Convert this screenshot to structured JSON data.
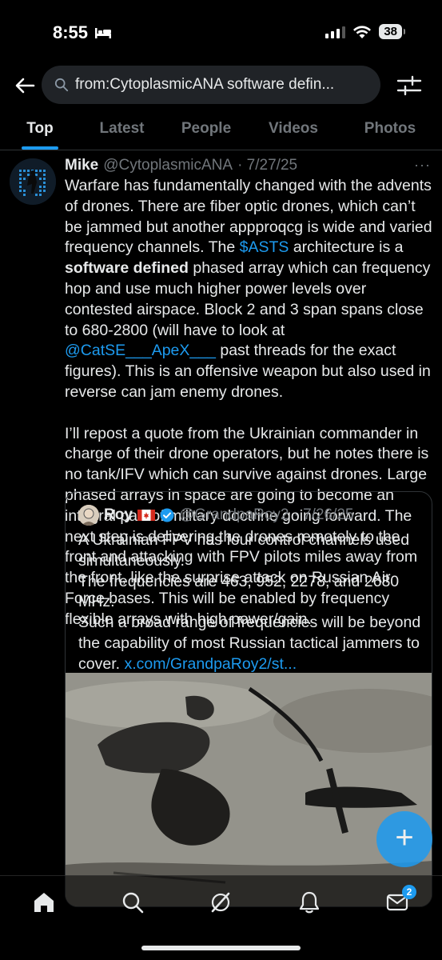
{
  "status_bar": {
    "time": "8:55",
    "battery": "38"
  },
  "search": {
    "query": "from:CytoplasmicANA software defin..."
  },
  "tabs": [
    "Top",
    "Latest",
    "People",
    "Videos",
    "Photos"
  ],
  "tweet": {
    "name": "Mike",
    "handle": "@CytoplasmicANA",
    "date": "· 7/27/25",
    "more": "···",
    "p1_a": "Warfare has fundamentally changed with the advents of drones. There are fiber optic drones, which can’t be jammed but another appproqcg is wide and varied frequency channels. The ",
    "p1_link": "$ASTS",
    "p1_b": " architecture is a ",
    "p1_bold": "software defined",
    "p1_c": " phased array which can frequency hop and use much higher power levels over contested airspace. Block 2 and 3 span spans close to 680-2800 (will have to look at ",
    "p1_link2": "@CatSE___ApeX___",
    "p1_d": " past threads for the exact figures). This is an offensive weapon but also used in reverse can jam enemy drones.",
    "p2": "I’ll repost a quote from the Ukrainian commander in charge of their drone operators, but he notes there is no tank/IFV which can survive against drones. Large phased arrays in space are going to become an integral part of military doctrine going forward. The next step is delivering the drones remotely to the front and attacking with FPV pilots miles away from the front, like the surprise attack on Russian Air Force bases. This will be enabled by frequency flexible arrays with high power/gain."
  },
  "quote": {
    "name": "Roy",
    "handle": "@GrandpaRoy2",
    "date": "· 7/26/25",
    "line1": "A Ukrainian FPV has four control channels used simultaneously.",
    "line2": "The frequencies are 463, 952, 2278, and 2680 MHz.",
    "line3": "Such a broad range of frequencies will be beyond the capability of most Russian tactical jammers to cover. ",
    "link": "x.com/GrandpaRoy2/st..."
  },
  "fab": {
    "label": "+"
  },
  "bottom_nav": {
    "items": [
      "home-icon",
      "search-icon",
      "grok-icon",
      "notifications-icon",
      "messages-icon"
    ],
    "messages_badge": "2"
  },
  "colors": {
    "accent": "#1d9bf0",
    "background": "#000000",
    "muted": "#71767b"
  }
}
